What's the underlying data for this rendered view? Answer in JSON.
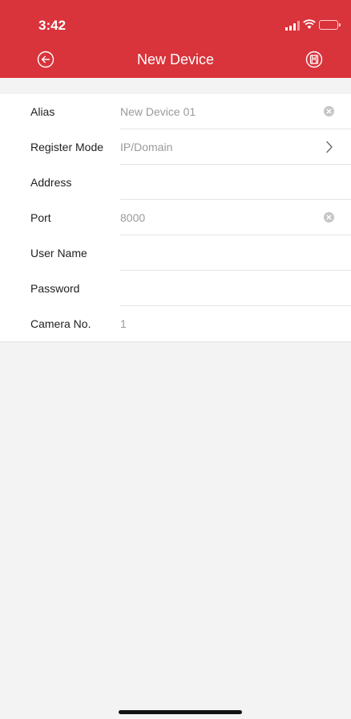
{
  "status_bar": {
    "time": "3:42",
    "icons": [
      "signal-icon",
      "wifi-icon",
      "battery-icon"
    ]
  },
  "header": {
    "title": "New Device",
    "back_icon": "back-arrow-circle-icon",
    "save_icon": "save-circle-icon",
    "color": "#d9333b"
  },
  "form": {
    "alias": {
      "label": "Alias",
      "value": "New Device 01"
    },
    "register_mode": {
      "label": "Register Mode",
      "value": "IP/Domain"
    },
    "address": {
      "label": "Address",
      "value": ""
    },
    "port": {
      "label": "Port",
      "value": "8000"
    },
    "user_name": {
      "label": "User Name",
      "value": ""
    },
    "password": {
      "label": "Password",
      "value": ""
    },
    "camera_no": {
      "label": "Camera No.",
      "value": "1"
    }
  }
}
